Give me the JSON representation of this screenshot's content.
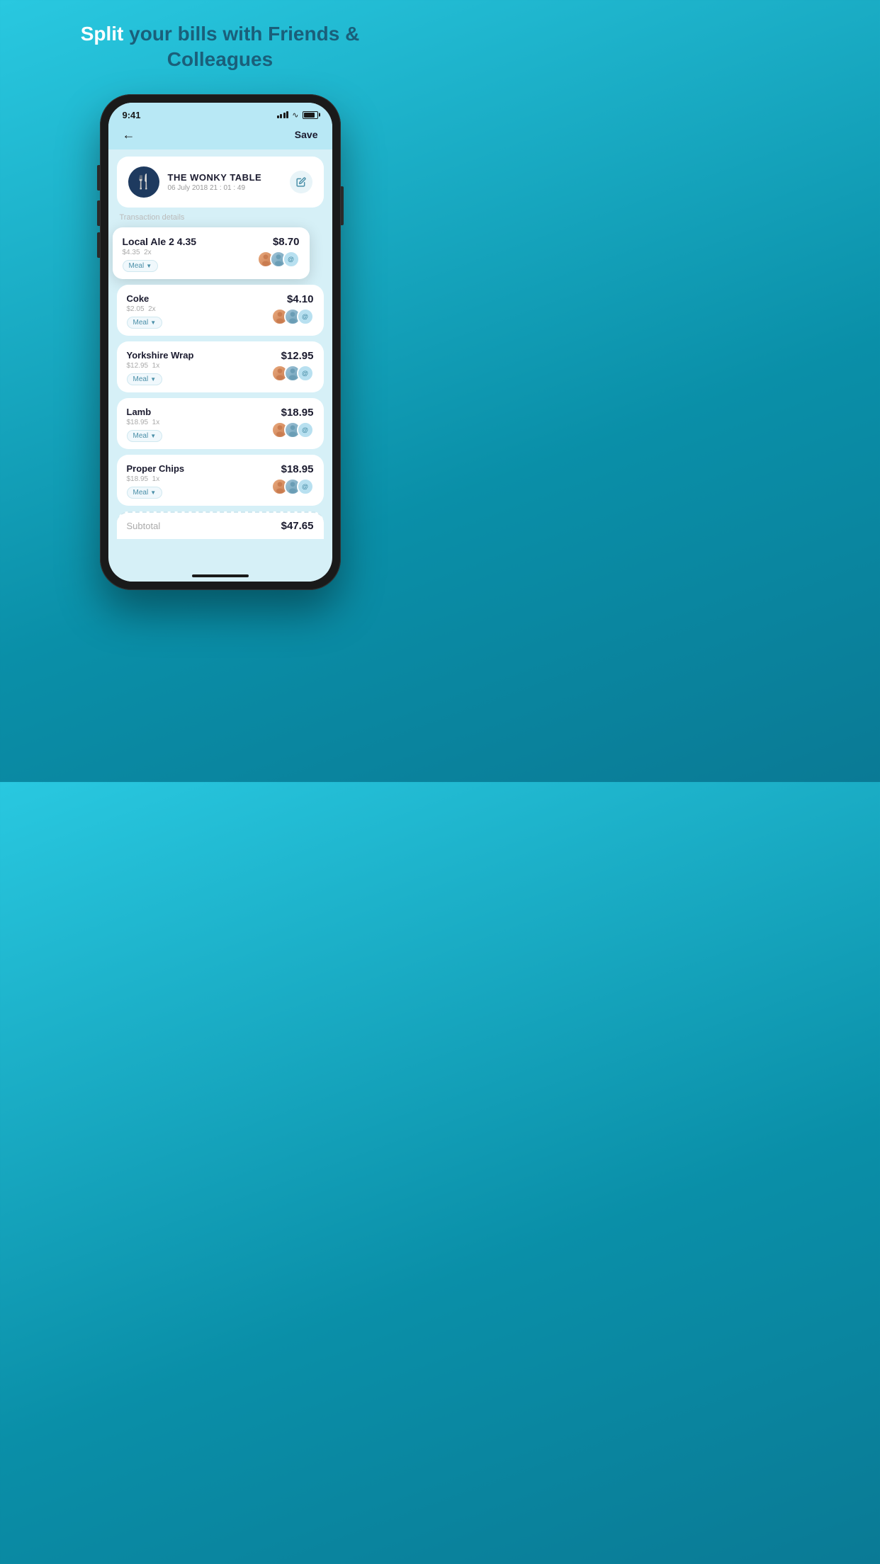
{
  "header": {
    "line1_bold": "Split",
    "line1_rest": " your bills with Friends &",
    "line2": "Colleagues"
  },
  "status_bar": {
    "time": "9:41",
    "save_label": "Save"
  },
  "restaurant": {
    "name": "THE WONKY TABLE",
    "date": "06 July 2018 21 : 01 : 49",
    "transaction_label": "Transaction details"
  },
  "items": [
    {
      "name": "Local Ale 2 4.35",
      "unit_price": "$4.35",
      "quantity": "2x",
      "price": "$8.70",
      "tag": "Meal",
      "is_popup": true
    },
    {
      "name": "Coke",
      "unit_price": "$2.05",
      "quantity": "2x",
      "price": "$4.10",
      "tag": "Meal",
      "is_popup": false
    },
    {
      "name": "Yorkshire Wrap",
      "unit_price": "$12.95",
      "quantity": "1x",
      "price": "$12.95",
      "tag": "Meal",
      "is_popup": false
    },
    {
      "name": "Lamb",
      "unit_price": "$18.95",
      "quantity": "1x",
      "price": "$18.95",
      "tag": "Meal",
      "is_popup": false
    },
    {
      "name": "Proper Chips",
      "unit_price": "$18.95",
      "quantity": "1x",
      "price": "$18.95",
      "tag": "Meal",
      "is_popup": false
    }
  ],
  "subtotal": {
    "label": "Subtotal",
    "amount": "$47.65"
  }
}
